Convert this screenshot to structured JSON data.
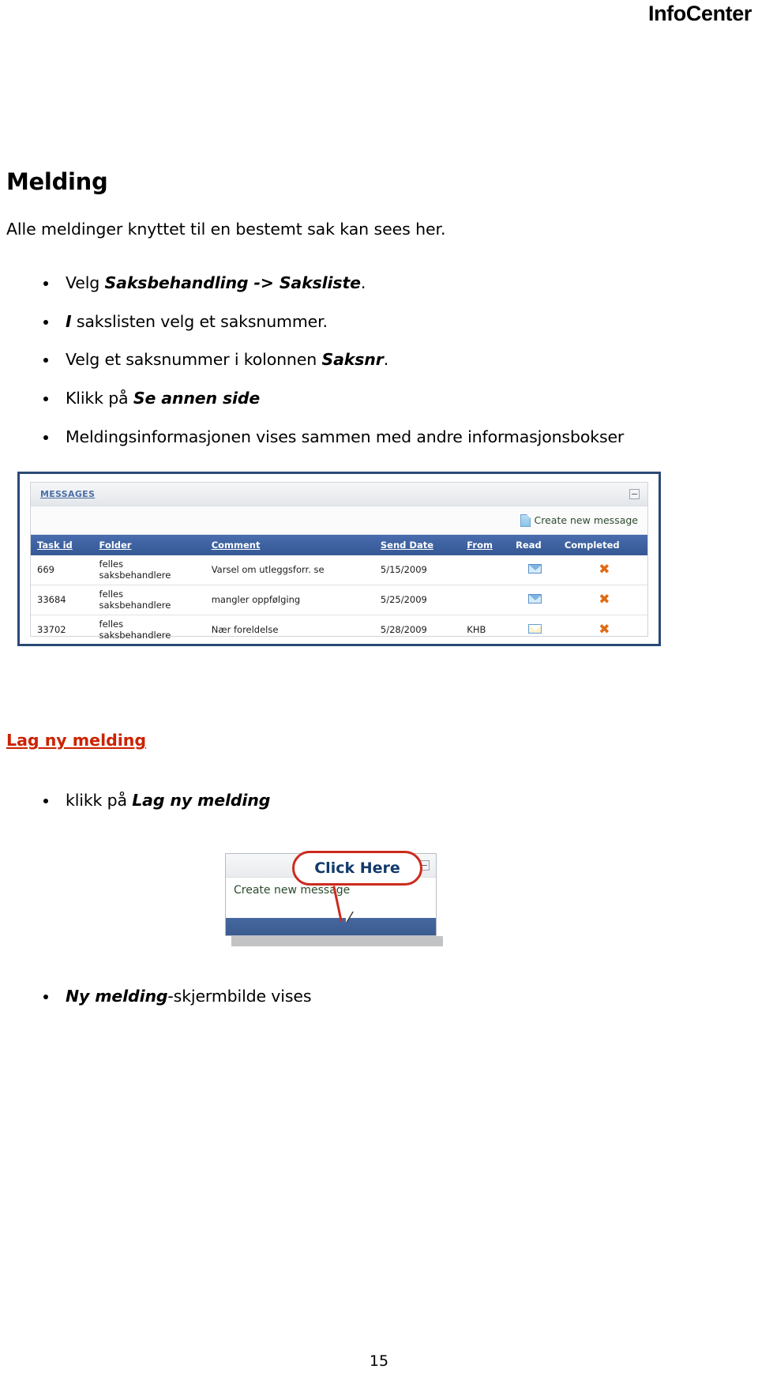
{
  "header": {
    "title": "InfoCenter"
  },
  "document": {
    "heading": "Melding",
    "intro": "Alle meldinger knyttet til en bestemt sak kan sees her.",
    "bullets": [
      {
        "pre": "Velg ",
        "emphasis": "Saksbehandling -> Saksliste",
        "post": "."
      },
      {
        "pre": "",
        "emphasis_lead": "I",
        "text": " sakslisten velg et saksnummer."
      },
      {
        "pre": "Velg et saksnummer i kolonnen ",
        "emphasis": "Saksnr",
        "post": "."
      },
      {
        "pre": "Klikk på ",
        "emphasis": "Se annen side",
        "post": ""
      },
      {
        "pre": "Meldingsinformasjonen vises sammen med andre informasjonsbokser",
        "emphasis": "",
        "post": ""
      }
    ],
    "section_link": "Lag ny melding",
    "bullet_click": {
      "pre": "klikk på ",
      "emphasis": "Lag ny melding"
    },
    "bullet_final": {
      "emphasis": "Ny melding",
      "post": "-skjermbilde vises"
    },
    "page_number": "15"
  },
  "messages_panel": {
    "panel_title": "MESSAGES",
    "create_link": "Create new message",
    "create_icon": "document-icon",
    "collapse_icon": "collapse-minus-icon",
    "columns": [
      "Task id",
      "Folder",
      "Comment",
      "Send Date",
      "From",
      "Read",
      "Completed"
    ],
    "rows": [
      {
        "task_id": "669",
        "folder": "felles\nsaksbehandlere",
        "comment": "Varsel om utleggsforr. se",
        "send_date": "5/15/2009",
        "from": "",
        "read_icon": "envelope-closed-icon",
        "completed_icon": "x-mark-icon"
      },
      {
        "task_id": "33684",
        "folder": "felles\nsaksbehandlere",
        "comment": "mangler oppfølging",
        "send_date": "5/25/2009",
        "from": "",
        "read_icon": "envelope-closed-icon",
        "completed_icon": "x-mark-icon"
      },
      {
        "task_id": "33702",
        "folder": "felles\nsaksbehandlere",
        "comment": "Nær foreldelse",
        "send_date": "5/28/2009",
        "from": "KHB",
        "read_icon": "envelope-open-icon",
        "completed_icon": "x-mark-icon"
      }
    ]
  },
  "callout_panel": {
    "callout_text": "Click Here",
    "create_link": "Create new message",
    "collapse_icon": "collapse-minus-icon",
    "cursor_icon": "mouse-pointer-icon"
  },
  "colors": {
    "panel_border": "#2b4a74",
    "table_header": "#3e62a0",
    "link_blue": "#4a6fa5",
    "link_red": "#cc2200",
    "callout_red": "#cc2b1d",
    "x_orange": "#e06b14"
  }
}
